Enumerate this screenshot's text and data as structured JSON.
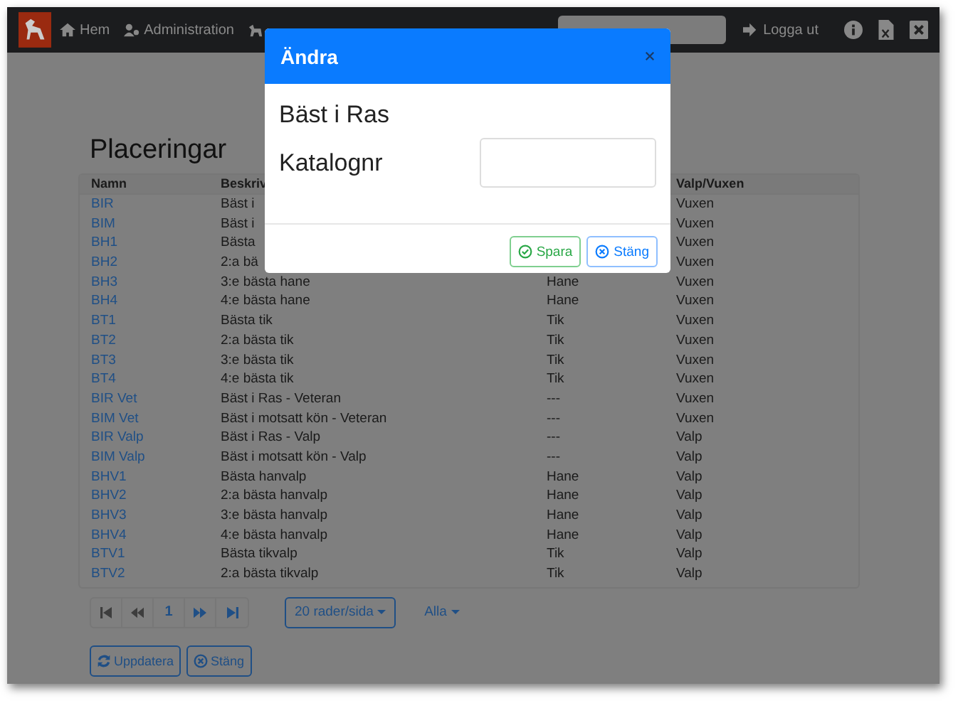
{
  "navbar": {
    "items": [
      {
        "kind": "home",
        "label": "Hem"
      },
      {
        "kind": "admin",
        "label": "Administration"
      },
      {
        "kind": "dog"
      }
    ],
    "logout": "Logga ut"
  },
  "page": {
    "title": "Placeringar"
  },
  "table": {
    "header": {
      "name": "Namn",
      "description": "Beskriv",
      "age_class": "Valp/Vuxen"
    },
    "rows": [
      {
        "name": "BIR",
        "description": "Bäst i",
        "age_class": "Vuxen"
      },
      {
        "name": "BIM",
        "description": "Bäst i",
        "age_class": "Vuxen"
      },
      {
        "name": "BH1",
        "description": "Bästa",
        "age_class": "Vuxen"
      },
      {
        "name": "BH2",
        "description": "2:a bä",
        "age_class": "Vuxen"
      },
      {
        "name": "BH3",
        "description": "3:e bästa hane",
        "column_3": "Hane",
        "age_class": "Vuxen"
      },
      {
        "name": "BH4",
        "description": "4:e bästa hane",
        "column_3": "Hane",
        "age_class": "Vuxen"
      },
      {
        "name": "BT1",
        "description": "Bästa tik",
        "column_3": "Tik",
        "age_class": "Vuxen"
      },
      {
        "name": "BT2",
        "description": "2:a bästa tik",
        "column_3": "Tik",
        "age_class": "Vuxen"
      },
      {
        "name": "BT3",
        "description": "3:e bästa tik",
        "column_3": "Tik",
        "age_class": "Vuxen"
      },
      {
        "name": "BT4",
        "description": "4:e bästa tik",
        "column_3": "Tik",
        "age_class": "Vuxen"
      },
      {
        "name": "BIR Vet",
        "description": "Bäst i Ras - Veteran",
        "column_3": "---",
        "age_class": "Vuxen"
      },
      {
        "name": "BIM Vet",
        "description": "Bäst i motsatt kön - Veteran",
        "column_3": "---",
        "age_class": "Vuxen"
      },
      {
        "name": "BIR Valp",
        "description": "Bäst i Ras - Valp",
        "column_3": "---",
        "age_class": "Valp"
      },
      {
        "name": "BIM Valp",
        "description": "Bäst i motsatt kön - Valp",
        "column_3": "---",
        "age_class": "Valp"
      },
      {
        "name": "BHV1",
        "description": "Bästa hanvalp",
        "column_3": "Hane",
        "age_class": "Valp"
      },
      {
        "name": "BHV2",
        "description": "2:a bästa hanvalp",
        "column_3": "Hane",
        "age_class": "Valp"
      },
      {
        "name": "BHV3",
        "description": "3:e bästa hanvalp",
        "column_3": "Hane",
        "age_class": "Valp"
      },
      {
        "name": "BHV4",
        "description": "4:e bästa hanvalp",
        "column_3": "Hane",
        "age_class": "Valp"
      },
      {
        "name": "BTV1",
        "description": "Bästa tikvalp",
        "column_3": "Tik",
        "age_class": "Valp"
      },
      {
        "name": "BTV2",
        "description": "2:a bästa tikvalp",
        "column_3": "Tik",
        "age_class": "Valp"
      }
    ]
  },
  "pagination": {
    "buttons": [
      {
        "kind": "first",
        "disabled": true
      },
      {
        "kind": "prev",
        "disabled": true
      },
      {
        "kind": "page",
        "label": "1",
        "disabled": false
      },
      {
        "kind": "next",
        "disabled": false
      },
      {
        "kind": "last",
        "disabled": false
      }
    ],
    "page_size": "20 rader/sida",
    "filter": "Alla"
  },
  "actions": [
    {
      "kind": "refresh",
      "label": "Uppdatera"
    },
    {
      "kind": "close",
      "label": "Stäng"
    }
  ],
  "modal": {
    "title": "Ändra",
    "heading": "Bäst i Ras",
    "field_label": "Katalognr",
    "buttons": [
      {
        "kind": "save",
        "label": "Spara"
      },
      {
        "kind": "close",
        "label": "Stäng"
      }
    ]
  }
}
